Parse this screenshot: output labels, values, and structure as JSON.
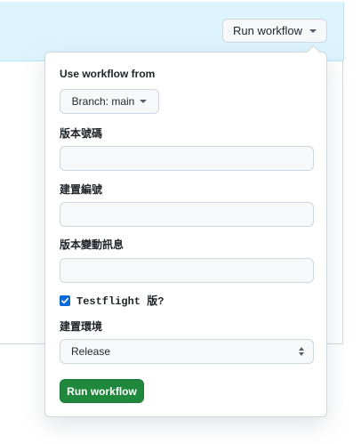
{
  "header": {
    "run_workflow_trigger_label": "Run workflow",
    "banner_color": "#ddf4ff"
  },
  "dialog": {
    "use_workflow_from_label": "Use workflow from",
    "branch_button_label": "Branch: main",
    "fields": [
      {
        "label": "版本號碼",
        "value": ""
      },
      {
        "label": "建置編號",
        "value": ""
      },
      {
        "label": "版本變動訊息",
        "value": ""
      }
    ],
    "testflight_checkbox": {
      "label": "Testflight 版?",
      "checked": true
    },
    "environment": {
      "label": "建置環境",
      "selected": "Release"
    },
    "submit_label": "Run workflow",
    "submit_color": "#1f883d"
  }
}
